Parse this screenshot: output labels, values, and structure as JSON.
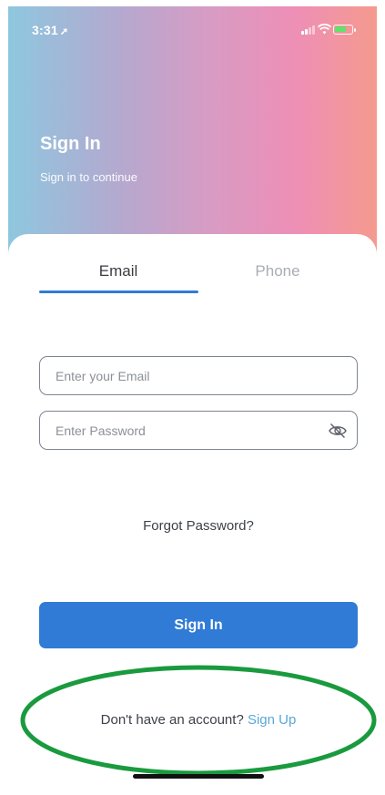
{
  "status_bar": {
    "time": "3:31",
    "location_icon": "location-arrow-icon",
    "battery_color": "#5fe36a"
  },
  "header": {
    "title": "Sign In",
    "subtitle": "Sign in to continue"
  },
  "tabs": [
    {
      "label": "Email",
      "active": true
    },
    {
      "label": "Phone",
      "active": false
    }
  ],
  "form": {
    "email_placeholder": "Enter your Email",
    "password_placeholder": "Enter Password",
    "forgot_label": "Forgot Password?",
    "submit_label": "Sign In"
  },
  "footer": {
    "prompt": "Don't have an account?",
    "signup_label": "Sign Up"
  },
  "colors": {
    "accent": "#2f7bd6",
    "link": "#5aa7d8",
    "highlight": "#1a9a3e",
    "gradient": [
      "#8ec7df",
      "#b4a9cf",
      "#ee8fb6",
      "#f59a8e"
    ]
  }
}
